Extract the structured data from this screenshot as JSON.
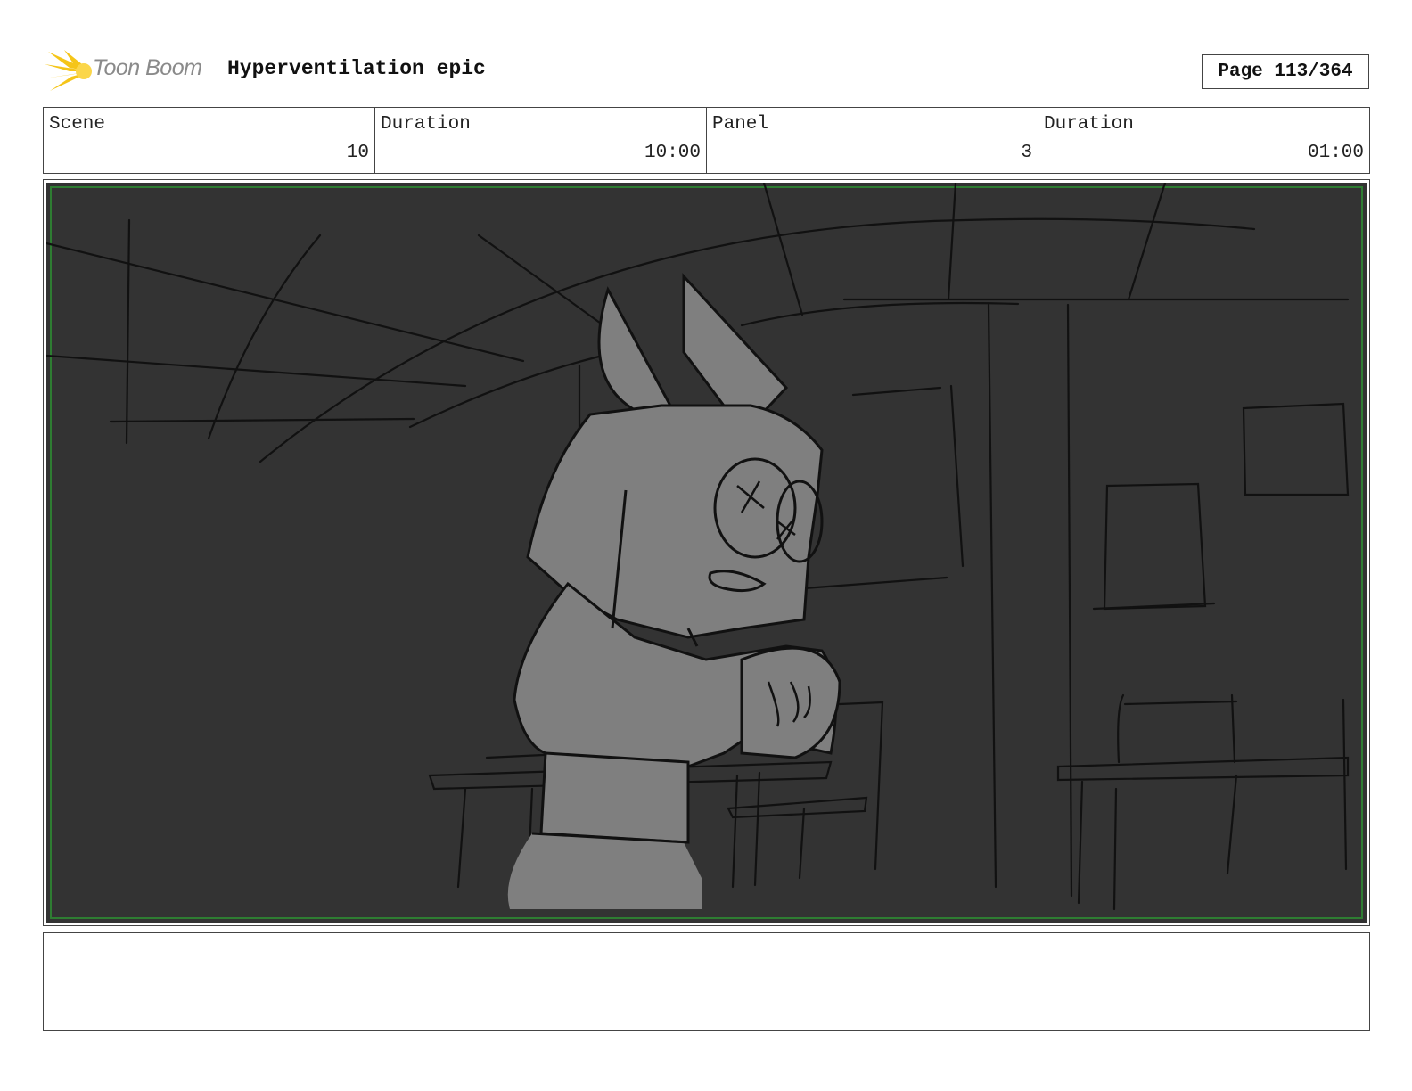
{
  "header": {
    "logo_text": "Toon Boom",
    "project_title": "Hyperventilation epic",
    "page_label": "Page 113/364"
  },
  "info": {
    "scene_label": "Scene",
    "scene_value": "10",
    "scene_duration_label": "Duration",
    "scene_duration_value": "10:00",
    "panel_label": "Panel",
    "panel_value": "3",
    "panel_duration_label": "Duration",
    "panel_duration_value": "01:00"
  },
  "colors": {
    "panel_background": "#333333",
    "character_fill": "#7f7f7f",
    "safe_frame": "#2e7d32",
    "logo_accent": "#f5c518"
  },
  "notes": {
    "text": ""
  }
}
